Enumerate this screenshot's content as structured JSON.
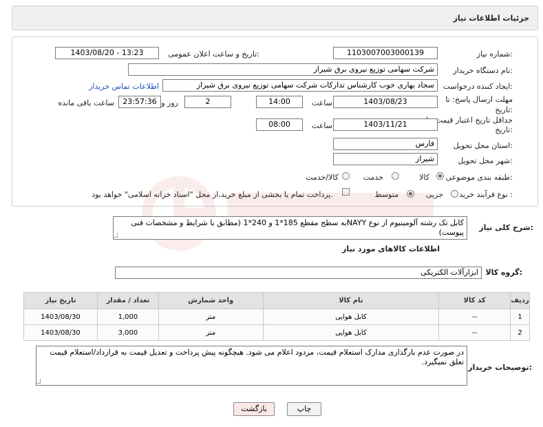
{
  "header": {
    "title": "جزئیات اطلاعات نیاز"
  },
  "form": {
    "need_number_label": "شماره نیاز:",
    "need_number": "1103007003000139",
    "announce_label": "تاریخ و ساعت اعلان عمومی:",
    "announce_value": "1403/08/20 - 13:23",
    "buyer_org_label": "نام دستگاه خریدار:",
    "buyer_org": "شرکت سهامی توزیع نیروی برق شیراز",
    "creator_label": "ایجاد کننده درخواست:",
    "creator": "سجاد بهاری خوب کارشناس تدارکات شرکت سهامی توزیع نیروی برق شیراز",
    "contact_link": "اطلاعات تماس خریدار",
    "deadline_label_1": "مهلت ارسال پاسخ: تا",
    "deadline_label_2": "تاریخ:",
    "deadline_date": "1403/08/23",
    "time_label": "ساعت",
    "deadline_time": "14:00",
    "days_value": "2",
    "days_label": "روز و",
    "remaining_time": "23:57:36",
    "remaining_label": "ساعت باقی مانده",
    "validity_label_1": "حداقل تاریخ اعتبار قیمت: تا",
    "validity_label_2": "تاریخ:",
    "validity_date": "1403/11/21",
    "validity_time": "08:00",
    "province_label": "استان محل تحویل:",
    "province": "فارس",
    "city_label": "شهر محل تحویل:",
    "city": "شیراز",
    "category_label": "طبقه بندی موضوعی:",
    "category_options": [
      "کالا",
      "خدمت",
      "کالا/خدمت"
    ],
    "process_label": "نوع فرآیند خرید :",
    "process_options": [
      "جزیی",
      "متوسط"
    ],
    "payment_note": "پرداخت تمام یا بخشی از مبلغ خرید،از محل \"اسناد خزانه اسلامی\" خواهد بود."
  },
  "description": {
    "label": "شرح کلی نیاز:",
    "text": "کابل تک رشته آلومینیوم از نوع NAYYبه سطح مقطع 185*1 و 240*1 (مطابق با شرایط و مشخصات فنی پیوست)"
  },
  "goods": {
    "section_title": "اطلاعات کالاهای مورد نیاز",
    "group_label": "گروه کالا:",
    "group_value": "ابزارآلات الکتریکی",
    "columns": [
      "ردیف",
      "کد کالا",
      "نام کالا",
      "واحد شمارش",
      "تعداد / مقدار",
      "تاریخ نیاز"
    ],
    "rows": [
      {
        "row": "1",
        "code": "--",
        "name": "کابل هوایی",
        "unit": "متر",
        "qty": "1,000",
        "date": "1403/08/30"
      },
      {
        "row": "2",
        "code": "--",
        "name": "کابل هوایی",
        "unit": "متر",
        "qty": "3,000",
        "date": "1403/08/30"
      }
    ]
  },
  "buyer_notes": {
    "label": "توضیحات خریدار:",
    "text": "در صورت عدم بارگذاری مدارک استعلام قیمت، مردود اعلام می شود. هیچگونه پیش پرداخت و تعدیل قیمت به قرارداد/استعلام قیمت تعلق نمیگیرد."
  },
  "buttons": {
    "print": "چاپ",
    "back": "بازگشت"
  },
  "colors": {
    "link": "#1a4fb8",
    "back_button_bg": "#fde8e8",
    "watermark": "#c0392b"
  }
}
